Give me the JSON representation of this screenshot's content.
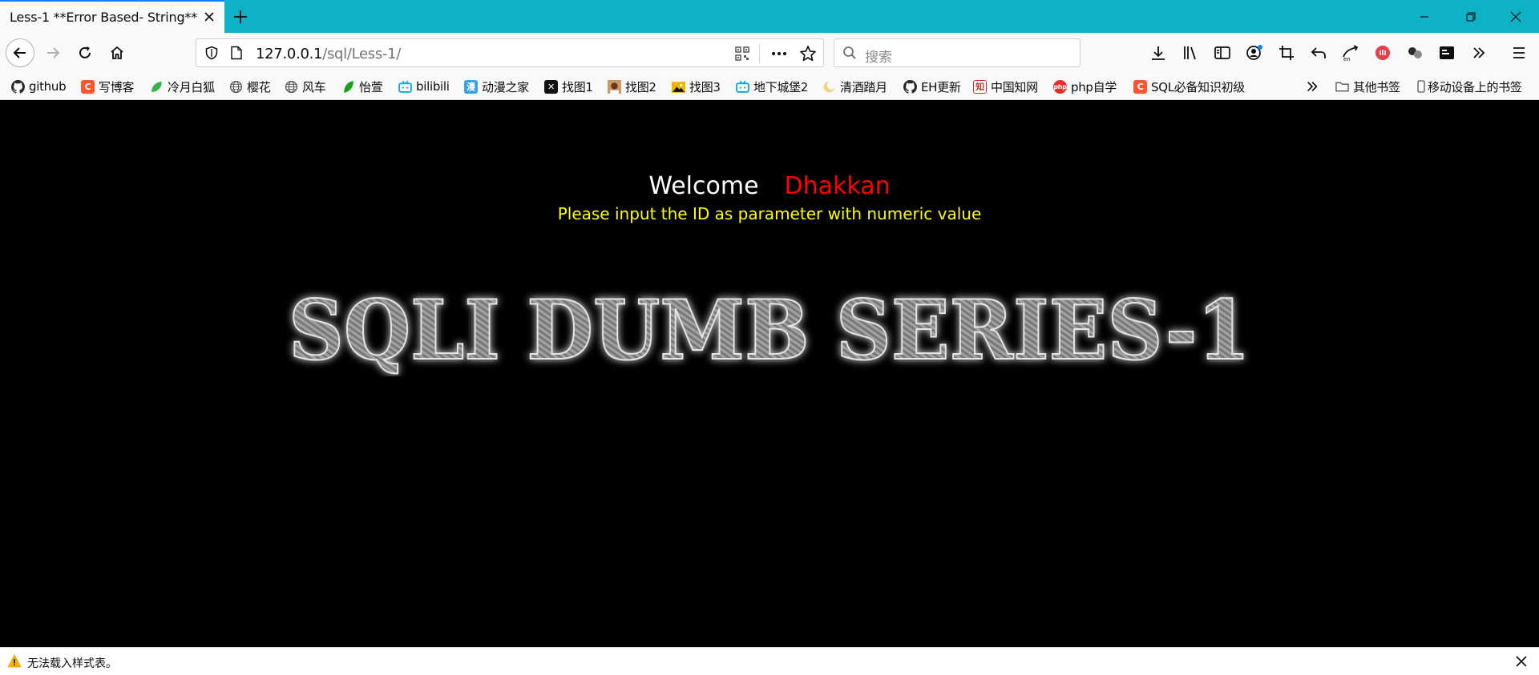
{
  "browser": {
    "tab": {
      "title": "Less-1 **Error Based- String**"
    },
    "url": {
      "host": "127.0.0.1",
      "path": "/sql/Less-1/"
    },
    "search": {
      "placeholder": "搜索"
    }
  },
  "bookmarks": [
    {
      "label": "github",
      "icon": "github-icon",
      "color": "#24292e"
    },
    {
      "label": "写博客",
      "icon": "csdn-icon",
      "color": "#fc5531"
    },
    {
      "label": "冷月白狐",
      "icon": "leaf-icon",
      "color": "#3cb34a"
    },
    {
      "label": "樱花",
      "icon": "globe-icon",
      "color": "#555555"
    },
    {
      "label": "风车",
      "icon": "globe-icon",
      "color": "#555555"
    },
    {
      "label": "怡萱",
      "icon": "green-leaf-icon",
      "color": "#1aa01a"
    },
    {
      "label": "bilibili",
      "icon": "bilibili-icon",
      "color": "#00a1d6"
    },
    {
      "label": "动漫之家",
      "icon": "manhua-icon",
      "color": "#3aa0e4"
    },
    {
      "label": "找图1",
      "icon": "x-square-icon",
      "color": "#111111"
    },
    {
      "label": "找图2",
      "icon": "portrait-icon",
      "color": "#8a5a3a"
    },
    {
      "label": "找图3",
      "icon": "picture-icon",
      "color": "#f0b400"
    },
    {
      "label": "地下城堡2",
      "icon": "bilibili-icon",
      "color": "#00a1d6"
    },
    {
      "label": "清酒踏月",
      "icon": "moon-icon",
      "color": "#e8b04a"
    },
    {
      "label": "EH更新",
      "icon": "github-icon",
      "color": "#24292e"
    },
    {
      "label": "中国知网",
      "icon": "cnki-icon",
      "color": "#c0392b"
    },
    {
      "label": "php自学",
      "icon": "php-icon",
      "color": "#e0302a"
    },
    {
      "label": "SQL必备知识初级",
      "icon": "csdn-icon",
      "color": "#fc5531"
    }
  ],
  "bookmarks_extra": {
    "other": "其他书签",
    "mobile": "移动设备上的书签"
  },
  "page": {
    "welcome": "Welcome",
    "username": "Dhakkan",
    "instruction": "Please input the ID as parameter with numeric value",
    "banner": "SQLI DUMB SERIES-1"
  },
  "notification": {
    "text": "无法载入样式表。"
  }
}
